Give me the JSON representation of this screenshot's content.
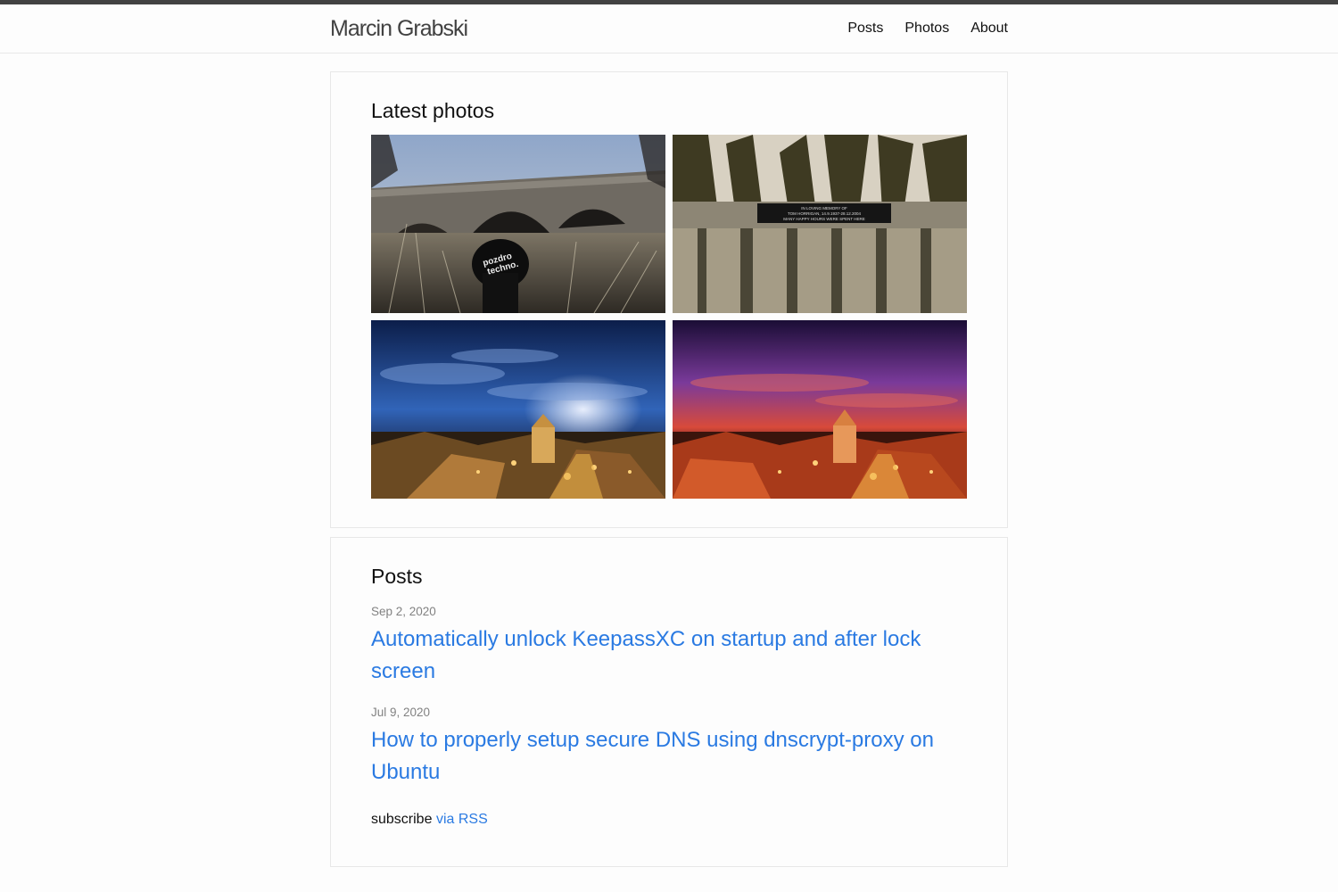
{
  "header": {
    "site_title": "Marcin Grabski",
    "nav": [
      "Posts",
      "Photos",
      "About"
    ]
  },
  "photos_section": {
    "title": "Latest photos",
    "photos": [
      {
        "icon": "photo-bridge-cap"
      },
      {
        "icon": "photo-memorial-bench"
      },
      {
        "icon": "photo-town-night-blue"
      },
      {
        "icon": "photo-town-sunset-red"
      }
    ],
    "embedded_text": {
      "cap_text": "pozdro techno.",
      "plaque_text": [
        "IN LOVING MEMORY OF",
        "TOM HORRIGAN, 14.9.1937-28.12.2004",
        "MANY HAPPY HOURS WERE SPENT HERE"
      ]
    }
  },
  "posts_section": {
    "title": "Posts",
    "posts": [
      {
        "date": "Sep 2, 2020",
        "title": "Automatically unlock KeepassXC on startup and after lock screen"
      },
      {
        "date": "Jul 9, 2020",
        "title": "How to properly setup secure DNS using dnscrypt-proxy on Ubuntu"
      }
    ],
    "subscribe_prefix": "subscribe",
    "subscribe_link": "via RSS"
  },
  "colors": {
    "link": "#2a7ae2",
    "topbar": "#424242",
    "meta": "#828282"
  }
}
